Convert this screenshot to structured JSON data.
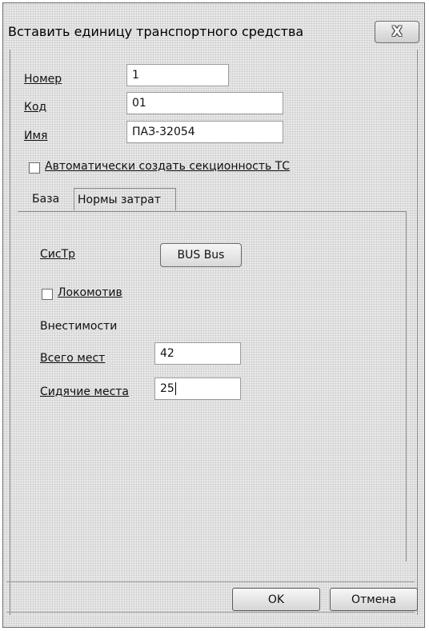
{
  "window": {
    "title": "Вставить единицу транспортного средства",
    "close_symbol": "X",
    "close_icon": "close-icon"
  },
  "fields": {
    "number": {
      "label": "Номер",
      "value": "1"
    },
    "code": {
      "label": "Код",
      "value": "01"
    },
    "name": {
      "label": "Имя",
      "value": "ПАЗ-32054"
    }
  },
  "auto_section": {
    "label": "Автоматически создать секционность ТС",
    "checked": false
  },
  "tabs": [
    {
      "label": "База",
      "active": true
    },
    {
      "label": "Нормы затрат",
      "active": false
    }
  ],
  "base_tab": {
    "sys_label": "СисТр",
    "sys_button": "BUS Bus",
    "locomotive": {
      "label": "Локомотив",
      "checked": false
    },
    "capacity_heading": "Внестимости",
    "total_seats": {
      "label": "Всего мест",
      "value": "42"
    },
    "sitting_seats": {
      "label": "Сидячие места",
      "value": "25"
    }
  },
  "buttons": {
    "ok": "OK",
    "cancel": "Отмена"
  }
}
